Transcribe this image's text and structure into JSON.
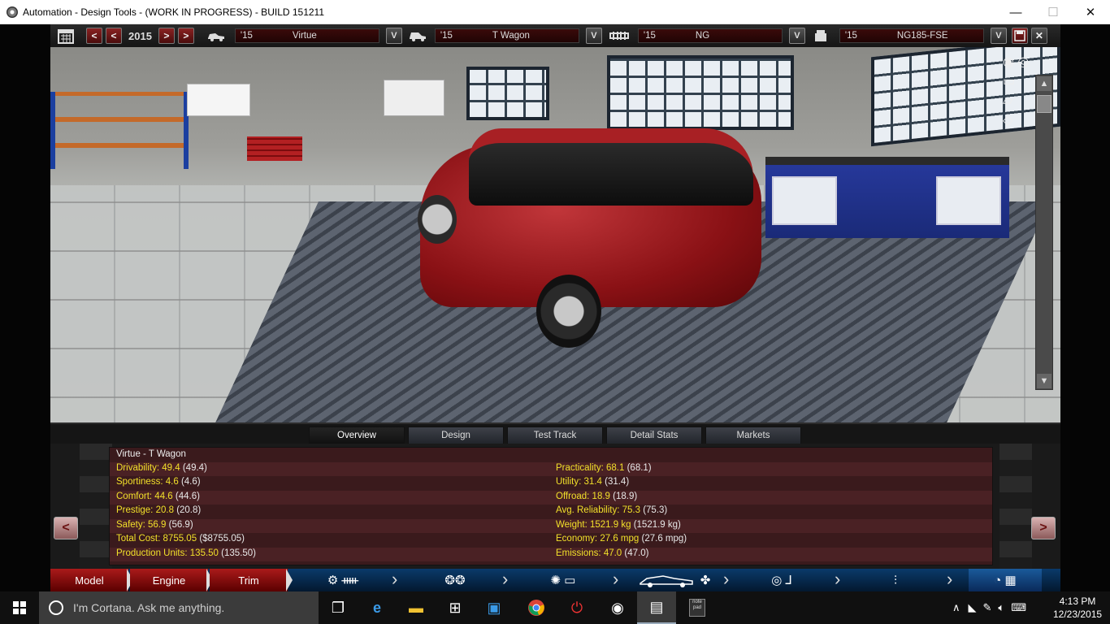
{
  "window": {
    "title": "Automation - Design Tools - (WORK IN PROGRESS) - BUILD 151211",
    "minimize": "—",
    "maximize": "☐",
    "close": "✕"
  },
  "topbar": {
    "calendar_icon": "calendar-icon",
    "prev_label": "<",
    "prev_fast_label": "<",
    "year": "2015",
    "next_label": ">",
    "next_fast_label": ">",
    "model_select": {
      "year": "'15",
      "name": "Virtue"
    },
    "trim_select": {
      "year": "'15",
      "name": "T Wagon"
    },
    "chassis_select": {
      "year": "'15",
      "name": "NG"
    },
    "engine_select": {
      "year": "'15",
      "name": "NG185-FSE"
    },
    "dropdown_label": "V"
  },
  "tabs": [
    {
      "label": "Overview",
      "active": true
    },
    {
      "label": "Design",
      "active": false
    },
    {
      "label": "Test Track",
      "active": false
    },
    {
      "label": "Detail Stats",
      "active": false
    },
    {
      "label": "Markets",
      "active": false
    }
  ],
  "stats": {
    "car_name": "Virtue - T Wagon",
    "left": [
      {
        "label": "Drivability:",
        "value": "49.4",
        "paren": "(49.4)"
      },
      {
        "label": "Sportiness:",
        "value": "4.6",
        "paren": "(4.6)"
      },
      {
        "label": "Comfort:",
        "value": "44.6",
        "paren": "(44.6)"
      },
      {
        "label": "Prestige:",
        "value": "20.8",
        "paren": "(20.8)"
      },
      {
        "label": "Safety:",
        "value": "56.9",
        "paren": "(56.9)"
      },
      {
        "label": "Total Cost:",
        "value": "8755.05",
        "paren": "($8755.05)"
      },
      {
        "label": "Production Units:",
        "value": "135.50",
        "paren": "(135.50)"
      }
    ],
    "right": [
      {
        "label": "Practicality:",
        "value": "68.1",
        "paren": "(68.1)"
      },
      {
        "label": "Utility:",
        "value": "31.4",
        "paren": "(31.4)"
      },
      {
        "label": "Offroad:",
        "value": "18.9",
        "paren": "(18.9)"
      },
      {
        "label": "Avg. Reliability:",
        "value": "75.3",
        "paren": "(75.3)"
      },
      {
        "label": "Weight:",
        "value": "1521.9 kg",
        "paren": "(1521.9 kg)"
      },
      {
        "label": "Economy:",
        "value": "27.6 mpg",
        "paren": "(27.6 mpg)"
      },
      {
        "label": "Emissions:",
        "value": "47.0",
        "paren": "(47.0)"
      }
    ],
    "prev_label": "<",
    "next_label": ">"
  },
  "bottomnav": {
    "model": "Model",
    "engine": "Engine",
    "trim": "Trim"
  },
  "taskbar": {
    "search_placeholder": "I'm Cortana. Ask me anything.",
    "time": "4:13 PM",
    "date": "12/23/2015",
    "notepad_label": "note pad"
  },
  "colors": {
    "stat_highlight": "#f2e02a",
    "accent_red": "#aa1a1a",
    "nav_blue": "#0a3a6a"
  }
}
